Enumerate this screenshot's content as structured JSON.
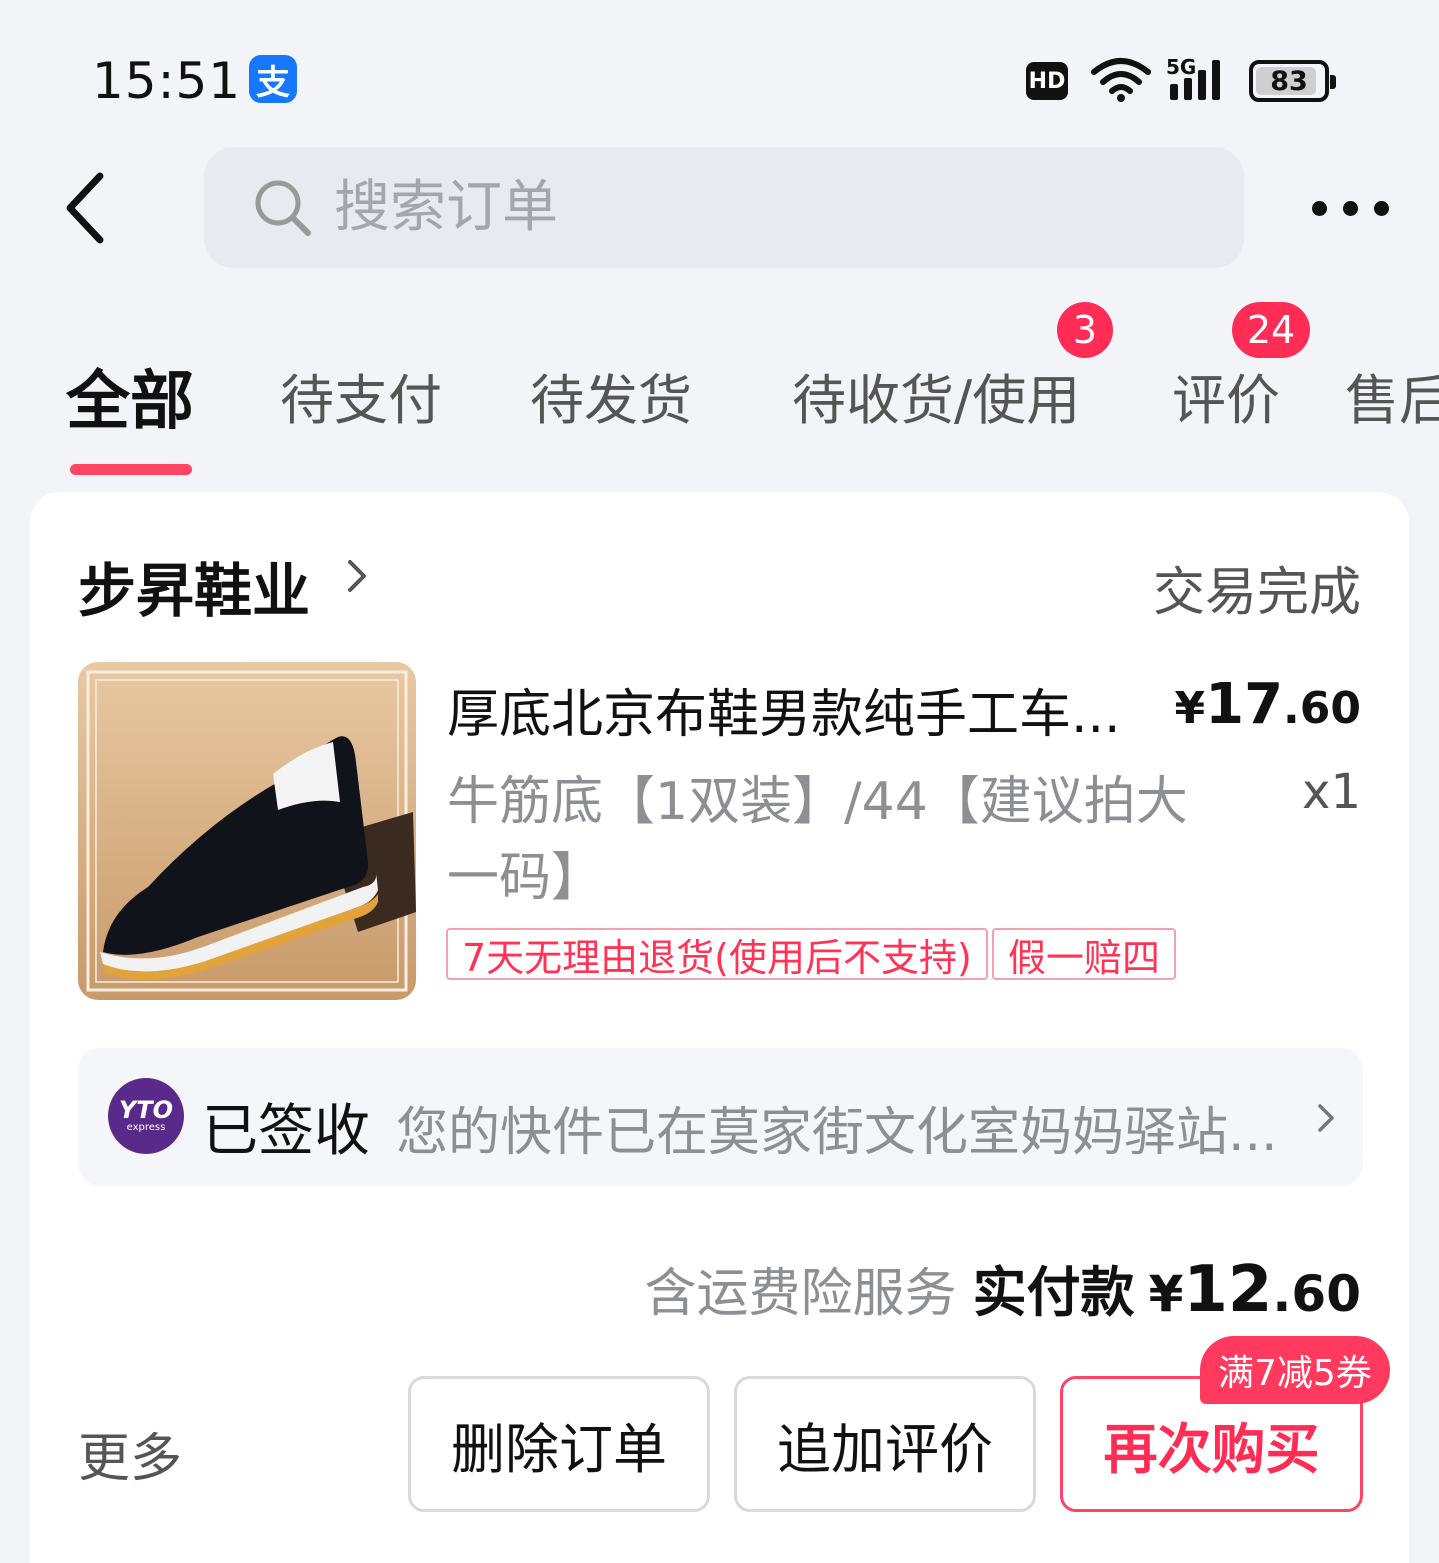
{
  "status_bar": {
    "time": "15:51",
    "app_icon": "alipay-icon",
    "hd": "HD",
    "network": "5G",
    "battery": "83"
  },
  "nav": {
    "search_placeholder": "搜索订单"
  },
  "tabs": [
    {
      "label": "全部",
      "active": true
    },
    {
      "label": "待支付"
    },
    {
      "label": "待发货"
    },
    {
      "label": "待收货/使用",
      "badge": "3"
    },
    {
      "label": "评价",
      "badge": "24"
    },
    {
      "label": "售后"
    }
  ],
  "order": {
    "shop_name": "步昇鞋业",
    "status": "交易完成",
    "product": {
      "title": "厚底北京布鞋男款纯手工车...",
      "price_symbol": "¥",
      "price_int": "17",
      "price_dec": ".60",
      "sku": "牛筋底【1双装】/44【建议拍大一码】",
      "quantity": "x1",
      "tags": [
        "7天无理由退货(使用后不支持)",
        "假一赔四"
      ]
    },
    "logistics": {
      "carrier_logo_text": "YTO",
      "carrier_logo_sub": "express",
      "status": "已签收",
      "detail": "您的快件已在莫家街文化室妈妈驿站..."
    },
    "payment": {
      "note": "含运费险服务",
      "label": "实付款",
      "symbol": "¥",
      "int": "12",
      "dec": ".60"
    },
    "actions": {
      "more": "更多",
      "delete": "删除订单",
      "review": "追加评价",
      "rebuy": "再次购买",
      "coupon": "满7减5券"
    }
  },
  "colors": {
    "accent": "#ff2d55",
    "page_bg": "#f3f4f8",
    "alipay_blue": "#1677ff"
  }
}
